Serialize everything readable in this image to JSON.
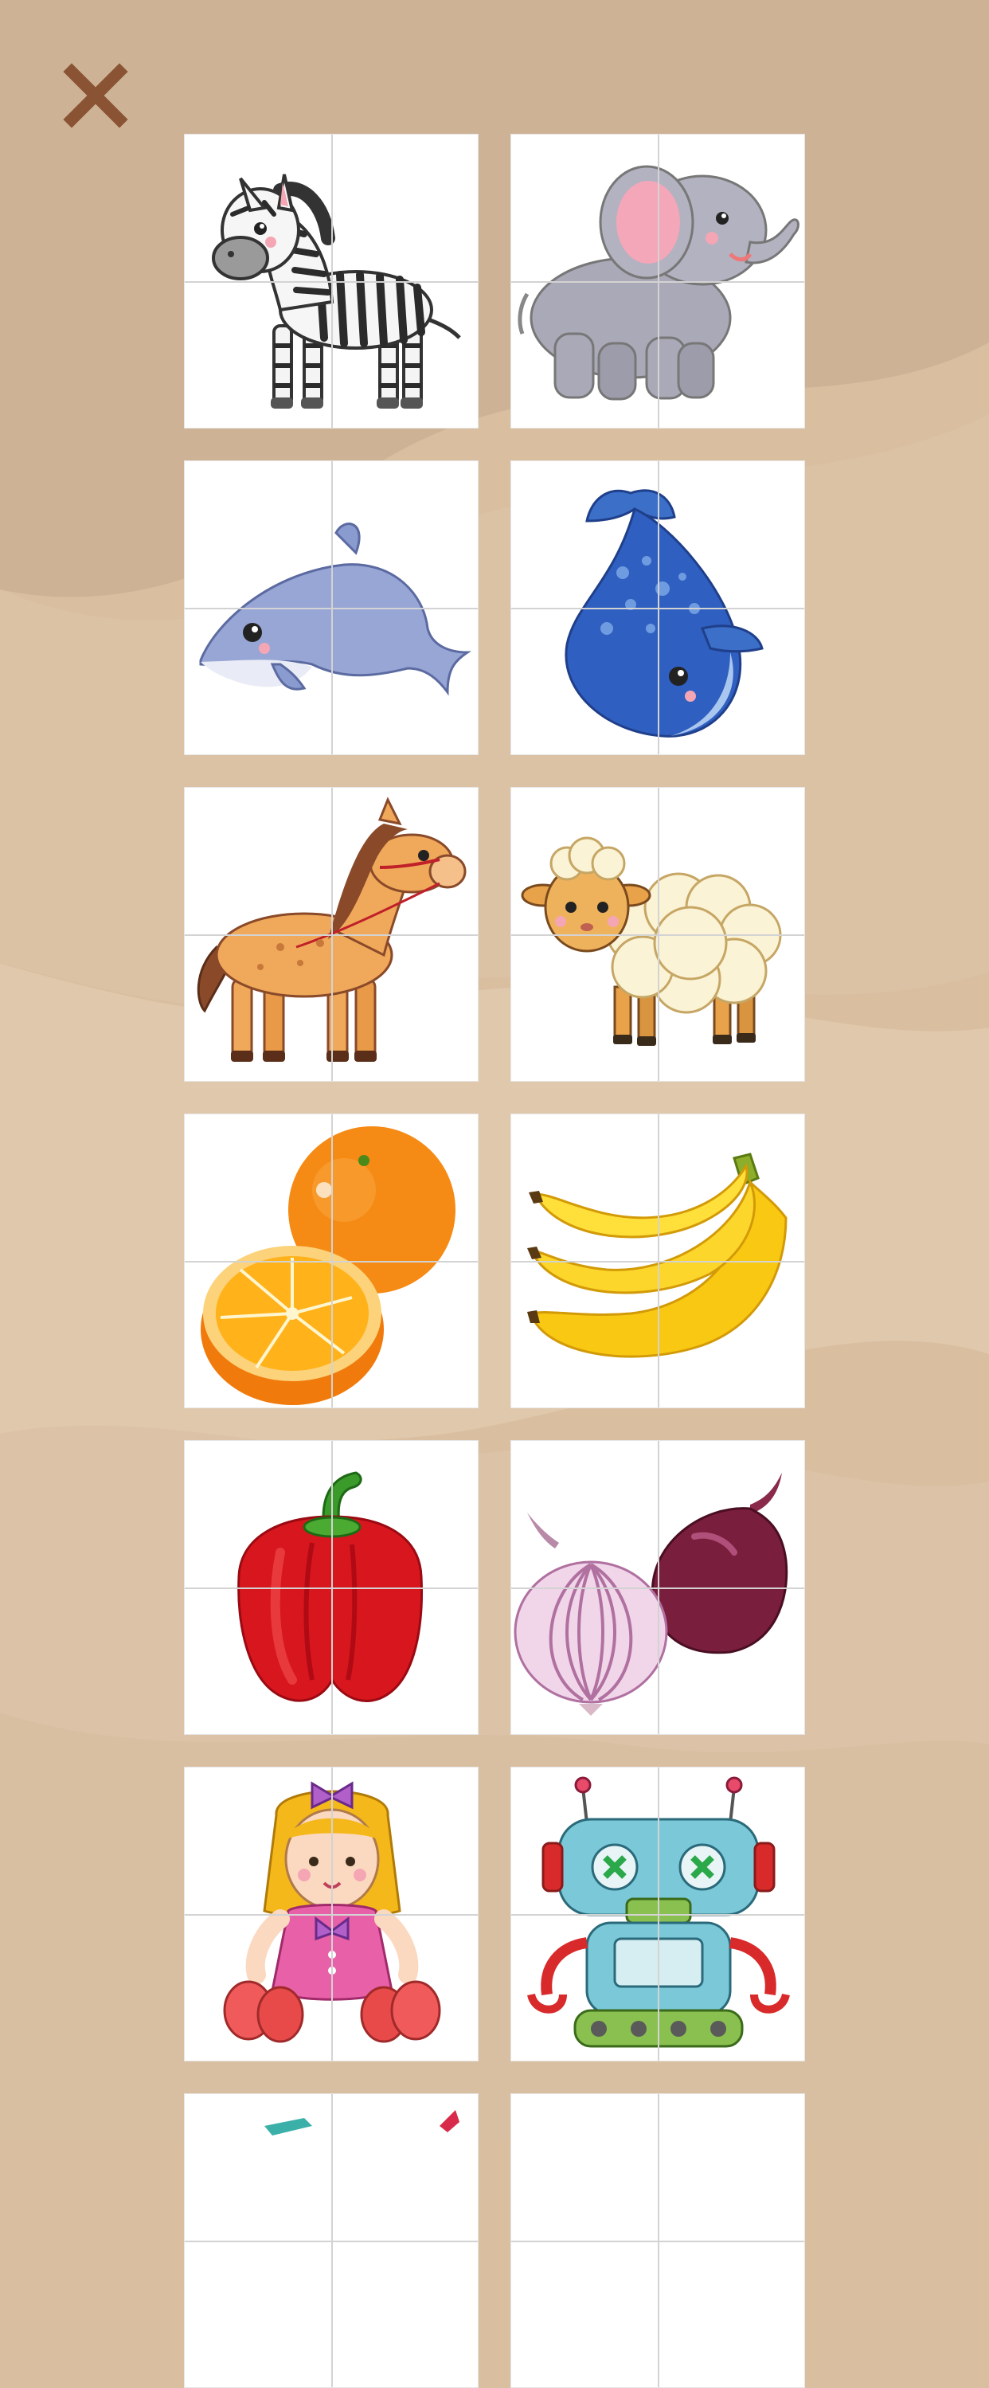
{
  "screen": "puzzle-picture-select",
  "colors": {
    "background": "#d9bea0",
    "background_light": "#e3ccb2",
    "background_dark": "#caad8e",
    "close_icon": "#8a5434",
    "tile_background": "#ffffff",
    "tile_grid_line": "#d3d3d3"
  },
  "close_button": {
    "icon": "close-icon"
  },
  "puzzle_tiles": [
    {
      "subject": "zebra",
      "icon": "zebra-illustration"
    },
    {
      "subject": "elephant",
      "icon": "elephant-illustration"
    },
    {
      "subject": "dolphin",
      "icon": "dolphin-illustration"
    },
    {
      "subject": "whale",
      "icon": "whale-illustration"
    },
    {
      "subject": "horse",
      "icon": "horse-illustration"
    },
    {
      "subject": "sheep",
      "icon": "sheep-illustration"
    },
    {
      "subject": "orange",
      "icon": "orange-illustration"
    },
    {
      "subject": "banana",
      "icon": "banana-illustration"
    },
    {
      "subject": "bell-pepper",
      "icon": "bell-pepper-illustration"
    },
    {
      "subject": "onion",
      "icon": "onion-illustration"
    },
    {
      "subject": "doll",
      "icon": "doll-illustration"
    },
    {
      "subject": "robot",
      "icon": "robot-illustration"
    },
    {
      "subject": "partially-visible",
      "icon": "partial-illustration"
    },
    {
      "subject": "partially-visible",
      "icon": "partial-illustration"
    }
  ],
  "tile_grid": {
    "pieces_per_tile": 4
  }
}
